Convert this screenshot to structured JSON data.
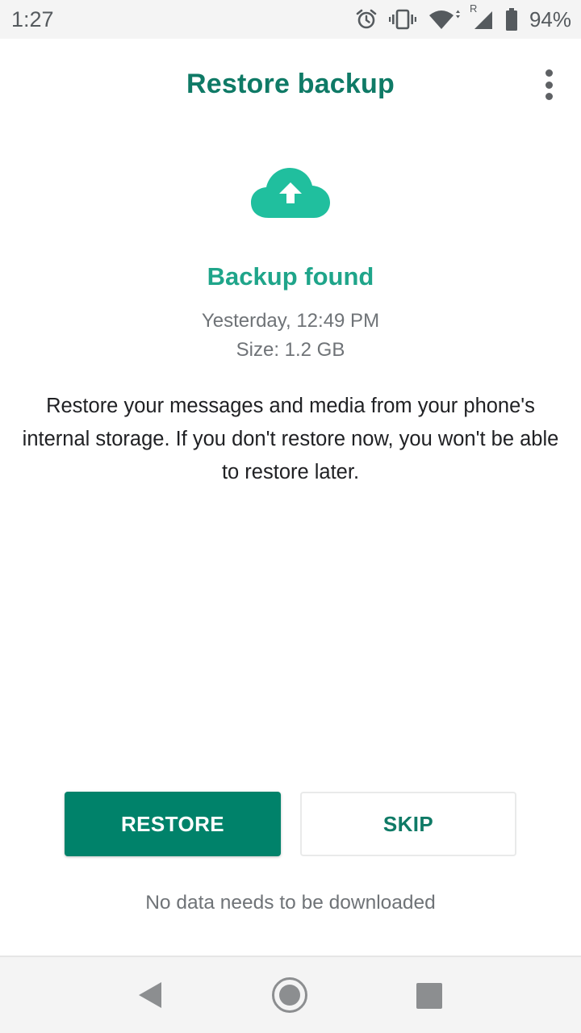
{
  "status_bar": {
    "time": "1:27",
    "roaming_indicator": "R",
    "battery_percent": "94%",
    "icons": [
      "alarm-icon",
      "vibrate-icon",
      "wifi-icon",
      "signal-icon",
      "battery-icon"
    ]
  },
  "header": {
    "title": "Restore backup",
    "menu_icon": "more-vert-icon"
  },
  "backup": {
    "icon": "cloud-upload-icon",
    "title": "Backup found",
    "date": "Yesterday, 12:49 PM",
    "size": "Size: 1.2 GB",
    "description": "Restore your messages and media from your phone's internal storage. If you don't restore now, you won't be able to restore later."
  },
  "actions": {
    "restore_label": "RESTORE",
    "skip_label": "SKIP",
    "note": "No data needs to be downloaded"
  },
  "nav_bar": {
    "icons": [
      "back-icon",
      "home-icon",
      "recents-icon"
    ]
  },
  "colors": {
    "title_green": "#0f7a66",
    "accent_green": "#1fa58a",
    "button_green": "#00826a",
    "cloud_green": "#20bf9e"
  }
}
